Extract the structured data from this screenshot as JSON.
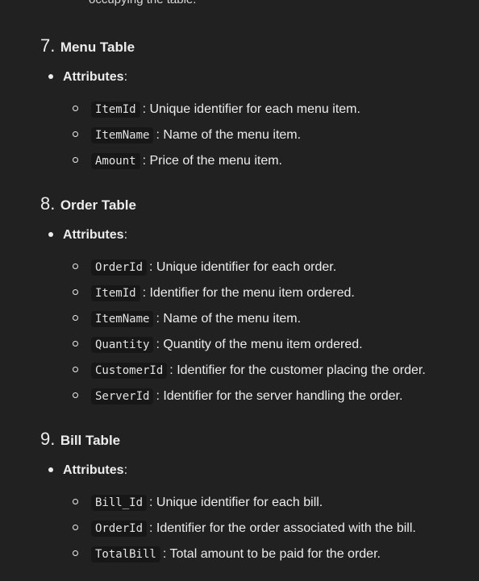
{
  "partial_top_text": "occupying the table.",
  "sections": [
    {
      "number": "7.",
      "title": "Menu Table",
      "attributes_label": "Attributes",
      "attributes_colon": ":",
      "items": [
        {
          "code": "ItemId",
          "desc": ": Unique identifier for each menu item."
        },
        {
          "code": "ItemName",
          "desc": ": Name of the menu item."
        },
        {
          "code": "Amount",
          "desc": ": Price of the menu item."
        }
      ]
    },
    {
      "number": "8.",
      "title": "Order Table",
      "attributes_label": "Attributes",
      "attributes_colon": ":",
      "items": [
        {
          "code": "OrderId",
          "desc": ": Unique identifier for each order."
        },
        {
          "code": "ItemId",
          "desc": ": Identifier for the menu item ordered."
        },
        {
          "code": "ItemName",
          "desc": ": Name of the menu item."
        },
        {
          "code": "Quantity",
          "desc": ": Quantity of the menu item ordered."
        },
        {
          "code": "CustomerId",
          "desc": ": Identifier for the customer placing the order."
        },
        {
          "code": "ServerId",
          "desc": ": Identifier for the server handling the order."
        }
      ]
    },
    {
      "number": "9.",
      "title": "Bill Table",
      "attributes_label": "Attributes",
      "attributes_colon": ":",
      "items": [
        {
          "code": "Bill_Id",
          "desc": ": Unique identifier for each bill."
        },
        {
          "code": "OrderId",
          "desc": ": Identifier for the order associated with the bill."
        },
        {
          "code": "TotalBill",
          "desc": ": Total amount to be paid for the order."
        }
      ]
    }
  ]
}
